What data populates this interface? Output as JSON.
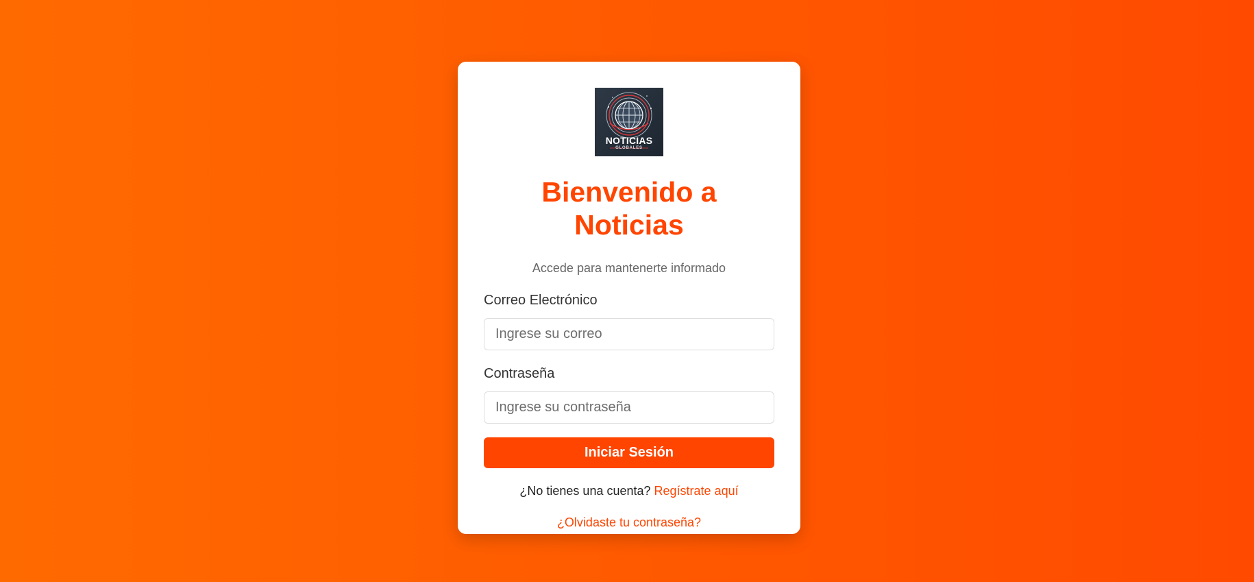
{
  "logo": {
    "text": "NOTICIAS",
    "subtext": "GLOBALES"
  },
  "header": {
    "title": "Bienvenido a Noticias",
    "subtitle": "Accede para mantenerte informado"
  },
  "form": {
    "email_label": "Correo Electrónico",
    "email_placeholder": "Ingrese su correo",
    "email_value": "",
    "password_label": "Contraseña",
    "password_placeholder": "Ingrese su contraseña",
    "password_value": "",
    "submit_label": "Iniciar Sesión"
  },
  "footer": {
    "no_account_text": "¿No tienes una cuenta?",
    "register_link": "Regístrate aquí",
    "forgot_link": "¿Olvidaste tu contraseña?"
  },
  "colors": {
    "accent": "#ff4500",
    "background_start": "#ff6a00",
    "background_end": "#ff4a00",
    "card": "#ffffff"
  },
  "icons": {
    "logo": "globe-icon"
  }
}
